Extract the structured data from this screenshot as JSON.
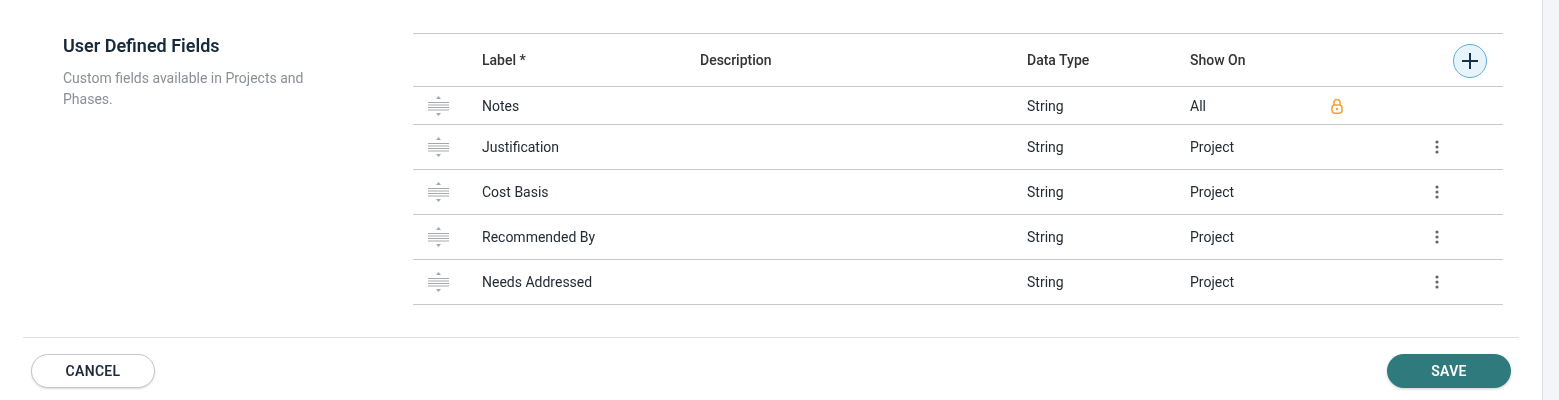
{
  "section": {
    "title": "User Defined Fields",
    "description": "Custom fields available in Projects and Phases."
  },
  "table": {
    "columns": [
      "Label *",
      "Description",
      "Data Type",
      "Show On"
    ],
    "rows": [
      {
        "label": "Notes",
        "data_type": "String",
        "show_on": "All",
        "locked": true
      },
      {
        "label": "Justification",
        "data_type": "String",
        "show_on": "Project",
        "locked": false
      },
      {
        "label": "Cost Basis",
        "data_type": "String",
        "show_on": "Project",
        "locked": false
      },
      {
        "label": "Recommended By",
        "data_type": "String",
        "show_on": "Project",
        "locked": false
      },
      {
        "label": "Needs Addressed",
        "data_type": "String",
        "show_on": "Project",
        "locked": false
      }
    ]
  },
  "buttons": {
    "cancel": "CANCEL",
    "save": "SAVE"
  }
}
